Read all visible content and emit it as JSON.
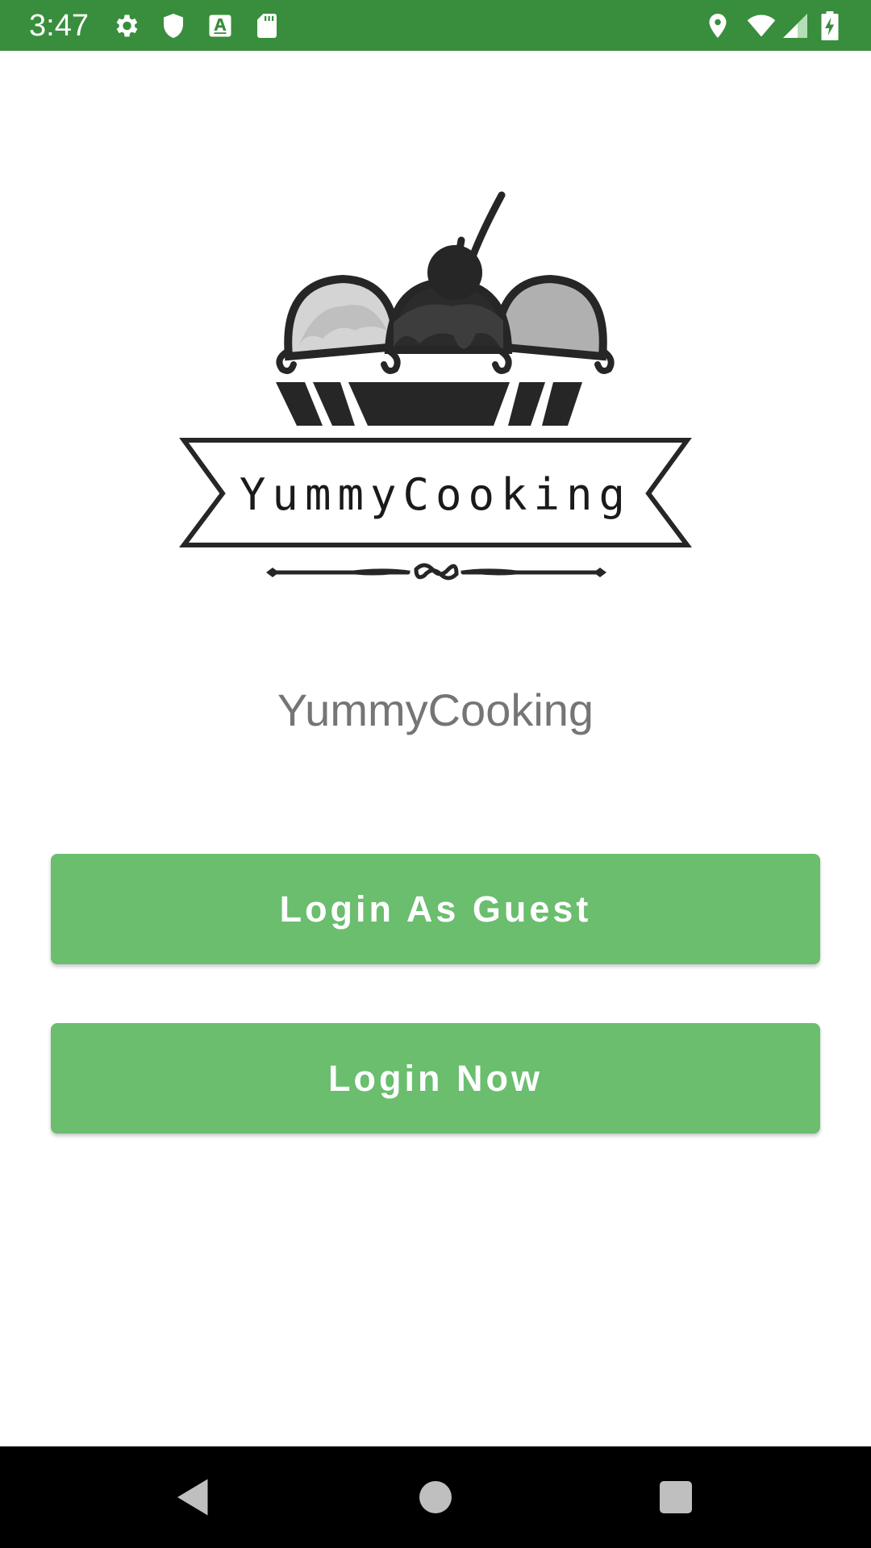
{
  "status_bar": {
    "time": "3:47",
    "left_icons": [
      "gear-icon",
      "shield-icon",
      "text-a-icon",
      "sd-card-icon"
    ],
    "right_icons": [
      "location-icon",
      "wifi-icon",
      "signal-icon",
      "battery-charging-icon"
    ],
    "color": "#388e3c"
  },
  "logo": {
    "text": "YummyCooking"
  },
  "app": {
    "title": "YummyCooking"
  },
  "buttons": {
    "guest_label": "Login As Guest",
    "login_label": "Login Now",
    "color": "#6abe6e"
  },
  "nav_bar": {
    "items": [
      "back-icon",
      "home-icon",
      "recents-icon"
    ]
  }
}
